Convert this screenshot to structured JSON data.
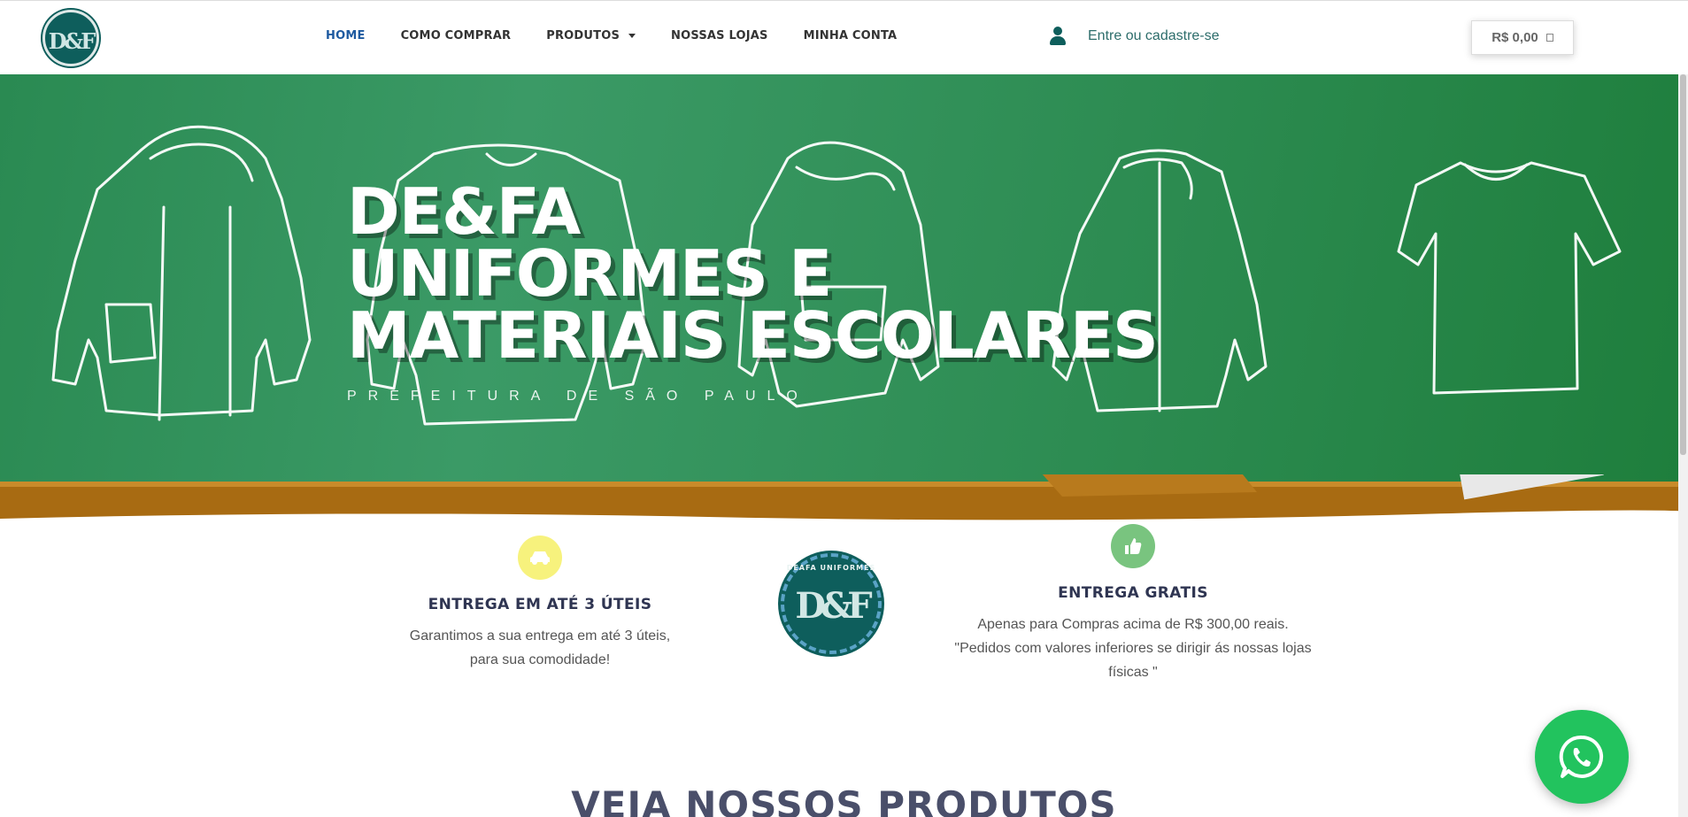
{
  "header": {
    "logo_alt": "DE&FA Uniformes",
    "logo_text": "D&F",
    "nav": [
      {
        "label": "HOME",
        "active": true
      },
      {
        "label": "COMO COMPRAR",
        "active": false
      },
      {
        "label": "PRODUTOS",
        "active": false,
        "dropdown": true
      },
      {
        "label": "NOSSAS LOJAS",
        "active": false
      },
      {
        "label": "MINHA CONTA",
        "active": false
      }
    ],
    "login_text": "Entre ou cadastre-se",
    "cart_total": "R$ 0,00"
  },
  "hero": {
    "title_lines": [
      "DE&FA",
      "UNIFORMES E",
      "MATERIAIS ESCOLARES"
    ],
    "subtitle": "PREFEITURA DE SÃO PAULO",
    "background_color": "#2f8e55"
  },
  "features": [
    {
      "icon": "car-icon",
      "title": "ENTREGA EM ATÉ 3 ÚTEIS",
      "text_lines": [
        "Garantimos a sua entrega em até 3 úteis,",
        "para sua comodidade!"
      ]
    },
    {
      "icon": "thumbs-up-icon",
      "title": "ENTREGA GRATIS",
      "text_lines": [
        "Apenas para Compras acima de R$ 300,00 reais.",
        "\"Pedidos com valores inferiores se dirigir ás nossas lojas",
        "físicas \""
      ]
    }
  ],
  "badge": {
    "ring_text": "DEAFA UNIFORMES",
    "text": "D&F"
  },
  "section_title": "VEJA NOSSOS PRODUTOS",
  "colors": {
    "brand_teal": "#0e5e5c",
    "nav_active": "#1e5aa0",
    "whatsapp_green": "#22c35e"
  }
}
